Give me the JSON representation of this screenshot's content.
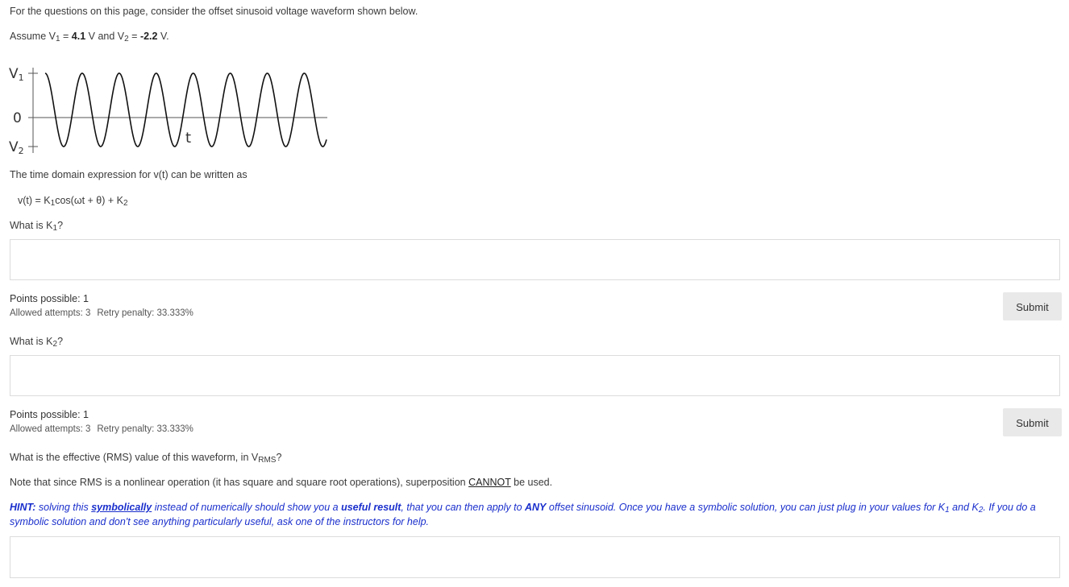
{
  "intro": "For the questions on this page, consider the offset sinusoid voltage waveform shown below.",
  "assume": {
    "prefix": "Assume V",
    "sub1": "1",
    "eq1": " = ",
    "v1": "4.1",
    "mid": " V and V",
    "sub2": "2",
    "eq2": " = ",
    "v2": "-2.2",
    "suffix": " V."
  },
  "waveform": {
    "label_v1": "V",
    "label_v1_sub": "1",
    "label_zero": "0",
    "label_v2": "V",
    "label_v2_sub": "2",
    "label_t": "t",
    "cycles": 7.6,
    "offset_fraction": 0.3
  },
  "expression_intro": "The time domain expression for v(t) can be written as",
  "formula": {
    "a": "v(t) = K",
    "sub1": "1",
    "b": "cos(ωt + θ) + K",
    "sub2": "2"
  },
  "q1": {
    "prefix": "What is K",
    "sub": "1",
    "suffix": "?"
  },
  "q1_meta": {
    "points": "Points possible: 1",
    "attempts": "Allowed attempts: 3",
    "penalty": "Retry penalty: 33.333%",
    "submit": "Submit"
  },
  "q2": {
    "prefix": "What is K",
    "sub": "2",
    "suffix": "?"
  },
  "q2_meta": {
    "points": "Points possible: 1",
    "attempts": "Allowed attempts: 3",
    "penalty": "Retry penalty: 33.333%",
    "submit": "Submit"
  },
  "q3": {
    "prefix": "What is the effective (RMS) value of this waveform, in V",
    "sub": "RMS",
    "suffix": "?"
  },
  "note": {
    "before": "Note that since RMS is a nonlinear operation (it has square and square root operations), superposition ",
    "strong": "CANNOT",
    "after": " be used."
  },
  "hint": {
    "label": "HINT:",
    "t1": " solving this ",
    "b1": "symbolically",
    "t2": " instead of numerically should show you a ",
    "b2": "useful result",
    "t3": ", that you can then apply to ",
    "b3": "ANY",
    "t4": " offset sinusoid. Once you have a symbolic solution, you can just plug in your values for K",
    "sub1": "1",
    "t5": " and K",
    "sub2": "2",
    "t6": ". If you do a symbolic solution and don't see anything particularly useful, ask one of the instructors for help."
  }
}
